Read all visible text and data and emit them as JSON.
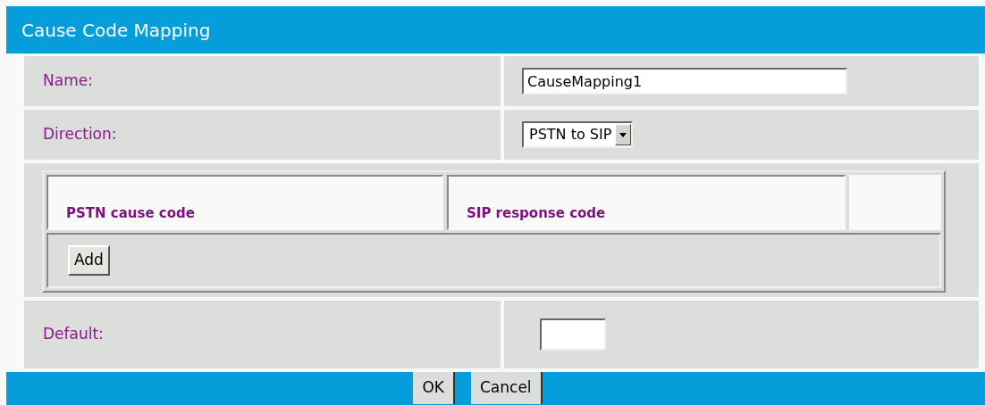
{
  "window": {
    "title": "Cause Code Mapping"
  },
  "fields": [
    {
      "kind": "text",
      "label": "Name:",
      "value": "CauseMapping1"
    },
    {
      "kind": "select",
      "label": "Direction:",
      "value": "PSTN to SIP"
    }
  ],
  "mapping_table": {
    "columns": [
      "PSTN cause code",
      "SIP response code"
    ],
    "add_button": "Add"
  },
  "default_field": {
    "label": "Default:"
  },
  "buttons": [
    "OK",
    "Cancel"
  ]
}
